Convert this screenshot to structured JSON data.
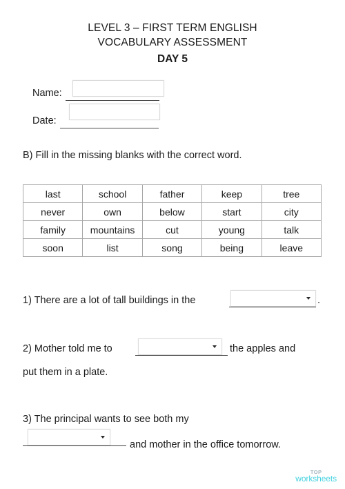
{
  "document": {
    "title_line_1": "LEVEL 3 – FIRST TERM ENGLISH",
    "title_line_2": "VOCABULARY ASSESSMENT",
    "title_day": "DAY 5"
  },
  "fields": {
    "name": {
      "label": "Name:",
      "value": "",
      "placeholder": ""
    },
    "date": {
      "label": "Date:",
      "value": "",
      "placeholder": ""
    }
  },
  "instruction": "B) Fill in the missing blanks with the correct word.",
  "word_bank": {
    "rows": [
      [
        "last",
        "school",
        "father",
        "keep",
        "tree"
      ],
      [
        "never",
        "own",
        "below",
        "start",
        "city"
      ],
      [
        "family",
        "mountains",
        "cut",
        "young",
        "talk"
      ],
      [
        "soon",
        "list",
        "song",
        "being",
        "leave"
      ]
    ]
  },
  "questions": [
    {
      "number": "1)",
      "text_before": "1) There are a lot of tall buildings in the",
      "text_after": ".",
      "answer_value": "",
      "control": "dropdown"
    },
    {
      "number": "2)",
      "text_before": "2) Mother told me to",
      "text_after": "the apples and",
      "text_continued": "put them in a plate.",
      "answer_value": "",
      "control": "dropdown"
    },
    {
      "number": "3)",
      "text_before": "3) The principal wants to see both my",
      "text_after": "and mother in the office tomorrow.",
      "answer_value": "",
      "control": "dropdown"
    }
  ],
  "footer": {
    "logo_top": "TOP",
    "logo_main": "worksheets",
    "accent_color": "#45d2e0"
  }
}
